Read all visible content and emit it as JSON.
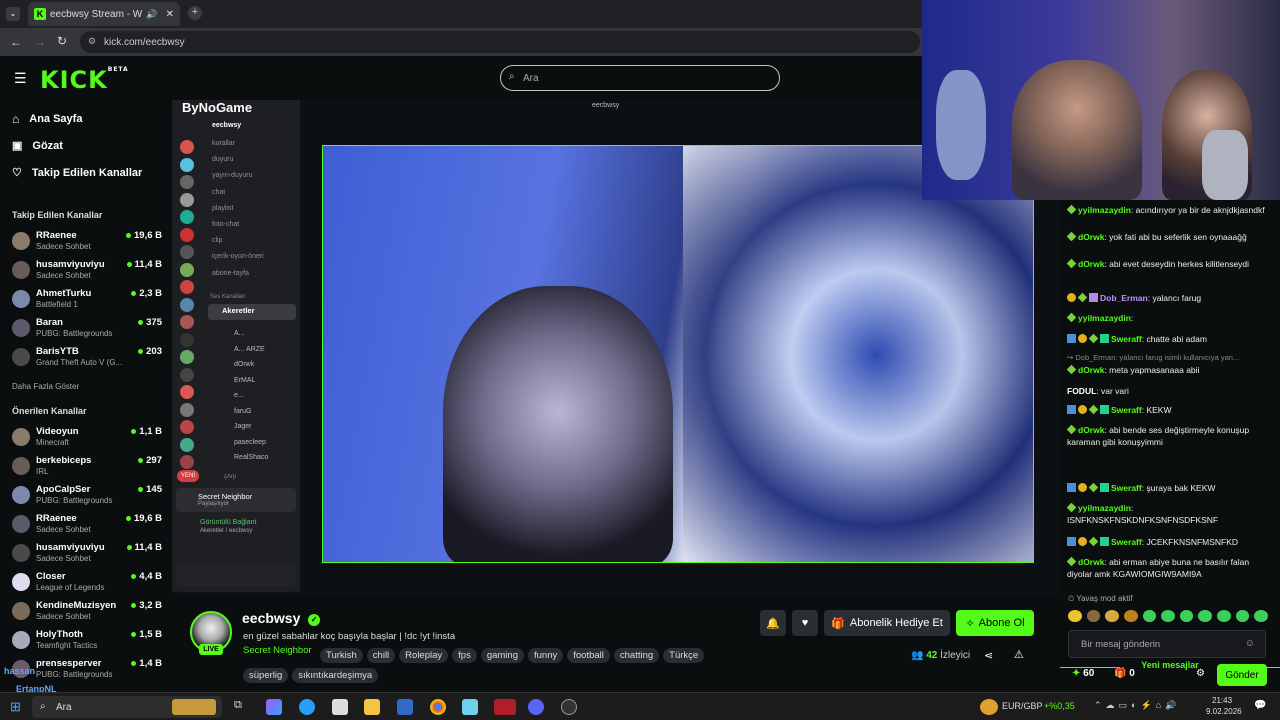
{
  "browser": {
    "tab_title": "eecbwsy Stream - Watch Li",
    "tab_favicon": "K",
    "url": "kick.com/eecbwsy"
  },
  "topbar": {
    "logo": "KICK",
    "logo_sup": "BETA",
    "search_placeholder": "Ara"
  },
  "sidebar": {
    "nav": [
      {
        "label": "Ana Sayfa",
        "icon": "home-icon"
      },
      {
        "label": "Gözat",
        "icon": "browse-icon"
      },
      {
        "label": "Takip Edilen Kanallar",
        "icon": "heart-icon"
      }
    ],
    "followed_title": "Takip Edilen Kanallar",
    "followed": [
      {
        "name": "RRaenee",
        "category": "Sadece Sohbet",
        "viewers": "19,6 B"
      },
      {
        "name": "husamviyuviyu",
        "category": "Sadece Sohbet",
        "viewers": "11,4 B"
      },
      {
        "name": "AhmetTurku",
        "category": "Battlefield 1",
        "viewers": "2,3 B"
      },
      {
        "name": "Baran",
        "category": "PUBG: Battlegrounds",
        "viewers": "375"
      },
      {
        "name": "BarisYTB",
        "category": "Grand Theft Auto V (G...",
        "viewers": "203"
      }
    ],
    "show_more": "Daha Fazla Göster",
    "recommended_title": "Önerilen Kanallar",
    "recommended": [
      {
        "name": "Videoyun",
        "category": "Minecraft",
        "viewers": "1,1 B"
      },
      {
        "name": "berkebiceps",
        "category": "IRL",
        "viewers": "297"
      },
      {
        "name": "ApoCalpSer",
        "category": "PUBG: Battlegrounds",
        "viewers": "145"
      },
      {
        "name": "RRaenee",
        "category": "Sadece Sohbet",
        "viewers": "19,6 B"
      },
      {
        "name": "husamviyuviyu",
        "category": "Sadece Sohbet",
        "viewers": "11,4 B"
      },
      {
        "name": "Closer",
        "category": "League of Legends",
        "viewers": "4,4 B"
      },
      {
        "name": "KendineMuzisyen",
        "category": "Sadece Sohbet",
        "viewers": "3,2 B"
      },
      {
        "name": "HolyThoth",
        "category": "Teamfight Tactics",
        "viewers": "1,5 B"
      },
      {
        "name": "prensesperver",
        "category": "PUBG: Battlegrounds",
        "viewers": "1,4 B"
      }
    ],
    "overlay_names": [
      "hassan",
      "ErtanpNL"
    ]
  },
  "video": {
    "overlay_title": "eecbwsy",
    "discord": {
      "server": "ByNoGame",
      "user": "eecbwsy",
      "channels": [
        "kurallar",
        "duyuru",
        "yayın-duyuru",
        "chat",
        "playlist",
        "foto-chat",
        "clip",
        "içerik-oyun-öneri",
        "abone-tayfa"
      ],
      "voice_section": "Ses Kanalları",
      "voice_channel": "Akeretler",
      "voice_users": [
        "A...",
        "A... ARZE",
        "dOrwk",
        "ErMAL",
        "e...",
        "faruG",
        "Jager",
        "pasecleep",
        "RealShaco"
      ],
      "yeni": "YENİ",
      "cikis": "çArp",
      "activity_title": "Secret Neighbor",
      "activity_sub": "Paylaşılıyor",
      "voice_connected": "Görüntülü Bağlant",
      "voice_connected_sub": "Akeretler / eecbwsy"
    }
  },
  "stream": {
    "streamer": "eecbwsy",
    "live_badge": "LIVE",
    "title": "en güzel sabahlar koç başıyla başlar | !dc !yt !insta",
    "category": "Secret Neighbor",
    "tags": [
      "Turkish",
      "chill",
      "Roleplay",
      "fps",
      "gaming",
      "funny",
      "football",
      "chatting",
      "Türkçe"
    ],
    "tags2": [
      "süperlig",
      "sıkıntıkardeşimya"
    ],
    "gift_button": "Abonelik Hediye Et",
    "subscribe_button": "Abone Ol",
    "viewers_count": "42",
    "viewers_label": "İzleyici"
  },
  "chat": {
    "messages": [
      {
        "user": "yyilmazaydin",
        "color": "green",
        "text": ": acındırıyor ya bir de aknjdkjasndkf",
        "badges": [
          "gem"
        ]
      },
      {
        "user": "dOrwk",
        "color": "green",
        "text": ": yok fati abi bu seferlik sen oynaaağğ",
        "badges": [
          "gem"
        ]
      },
      {
        "user": "dOrwk",
        "color": "green",
        "text": ": abi evet deseydin herkes kilitlenseydi",
        "badges": [
          "gem"
        ]
      },
      {
        "user": "Dob_Erman",
        "color": "purple",
        "text": ": yalancı farug",
        "badges": [
          "gold",
          "gem",
          "purple"
        ]
      },
      {
        "user": "yyilmazaydin",
        "color": "green",
        "text": ": ",
        "badges": [
          "gem"
        ]
      },
      {
        "user": "Sweraff",
        "color": "green",
        "text": ": chatte abi adam",
        "badges": [
          "blue",
          "gold",
          "gem",
          "teal"
        ]
      },
      {
        "user": "Dob_Erman: yalancı farug isimli kullanıcıya yan...",
        "color": "reply",
        "text": "",
        "badges": []
      },
      {
        "user": "dOrwk",
        "color": "green",
        "text": ": meta yapmasanaaa abii",
        "badges": [
          "gem"
        ]
      },
      {
        "user": "FODUL",
        "color": "white",
        "text": ": var vari",
        "badges": []
      },
      {
        "user": "Sweraff",
        "color": "green",
        "text": ": KEKW",
        "badges": [
          "blue",
          "gold",
          "gem",
          "teal"
        ]
      },
      {
        "user": "dOrwk",
        "color": "green",
        "text": ": abi bende ses değiştirmeyle konuşup karaman gibi konuşyimmi",
        "badges": [
          "gem"
        ]
      }
    ],
    "new_messages": "Yeni mesajlar",
    "messages2": [
      {
        "user": "Sweraff",
        "color": "green",
        "text": ": şuraya bak KEKW",
        "badges": [
          "blue",
          "gold",
          "gem",
          "teal"
        ]
      },
      {
        "user": "yyilmazaydin",
        "color": "green",
        "text": ": ISNFKNSKFNSKDNFKSNFNSDFKSNF",
        "badges": [
          "gem"
        ]
      },
      {
        "user": "Sweraff",
        "color": "green",
        "text": ": JCEKFKNSNFMSNFKD",
        "badges": [
          "blue",
          "gold",
          "gem",
          "teal"
        ]
      },
      {
        "user": "dOrwk",
        "color": "green",
        "text": ": abi erman abiye buna ne basılır falan diyolar amk KGAWIOMGIW9AMI9A",
        "badges": [
          "gem"
        ]
      }
    ],
    "slow_mode": "Yavaş mod aktif",
    "input_placeholder": "Bir mesaj gönderin",
    "points": "60",
    "gift_count": "0",
    "send_button": "Gönder"
  },
  "taskbar": {
    "search_placeholder": "Ara",
    "currency": "EUR/GBP",
    "currency_change": "+%0,35",
    "time": "21:43",
    "date": "9.02.2026"
  },
  "colors": {
    "accent": "#53fc18",
    "bg": "#0b0e0f",
    "panel": "#2a2d31"
  }
}
